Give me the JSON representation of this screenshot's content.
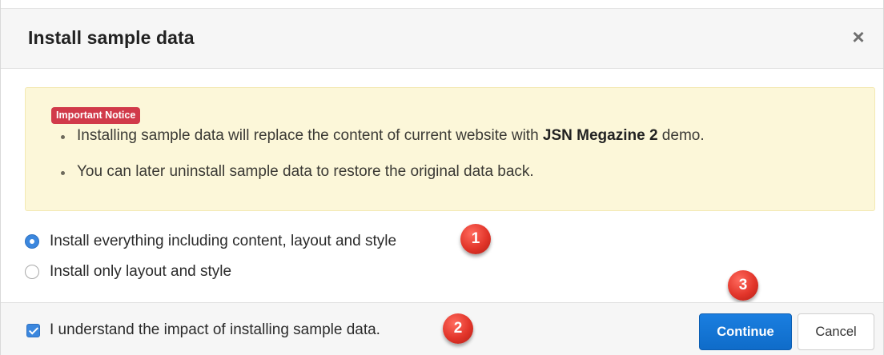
{
  "dialog": {
    "title": "Install sample data",
    "close_symbol": "×"
  },
  "notice": {
    "badge": "Important Notice",
    "item1_prefix": "Installing sample data will replace the content of current website with ",
    "item1_strong": "JSN Megazine 2",
    "item1_suffix": " demo.",
    "item2": "You can later uninstall sample data to restore the original data back."
  },
  "options": [
    {
      "label": "Install everything including content, layout and style",
      "checked": true
    },
    {
      "label": "Install only layout and style",
      "checked": false
    }
  ],
  "footer": {
    "agree_label": "I understand the impact of installing sample data.",
    "agree_checked": true,
    "continue_label": "Continue",
    "cancel_label": "Cancel"
  },
  "markers": [
    "1",
    "2",
    "3"
  ],
  "colors": {
    "primary": "#0f6cc9",
    "badge": "#d13a4a",
    "notice_bg": "#fcf7d9",
    "marker": "#e2352a"
  },
  "icons": {
    "close": "close-icon",
    "radio": "radio-icon",
    "checkbox": "checkbox-icon",
    "bullet": "bullet-icon"
  }
}
